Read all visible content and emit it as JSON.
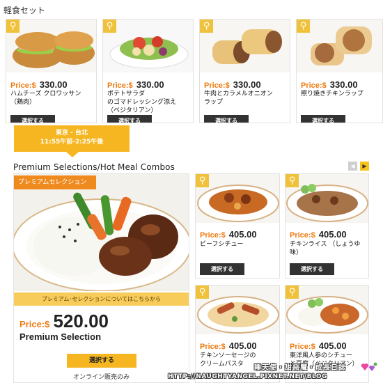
{
  "section1": {
    "title": "軽食セット",
    "items": [
      {
        "price_label": "Price:$",
        "price": "330.00",
        "name": "ハムチーズ クロワッサン\n（鶏肉）",
        "button": "選択する",
        "icon": "zoom-icon"
      },
      {
        "price_label": "Price:$",
        "price": "330.00",
        "name": "ポテトサラダ\nのゴマドレッシング添え\n（ベジタリアン）",
        "button": "選択する",
        "icon": "zoom-icon"
      },
      {
        "price_label": "Price:$",
        "price": "330.00",
        "name": "牛肉とカラメルオニオン\nラップ",
        "button": "選択する",
        "icon": "zoom-icon"
      },
      {
        "price_label": "Price:$",
        "price": "330.00",
        "name": "照り焼きチキンラップ",
        "button": "選択する",
        "icon": "zoom-icon"
      }
    ]
  },
  "flight": {
    "route": "東京 - 台北",
    "time": "11:55午前-2:25午後"
  },
  "section2": {
    "title": "Premium Selections/Hot Meal Combos",
    "nav_prev_icon": "arrow-left-icon",
    "nav_next_icon": "arrow-right-icon",
    "premium": {
      "banner": "プレミアムセレクション",
      "link": "プレミアム･セレクションについてはこちらから",
      "price_label": "Price:$",
      "price": "520.00",
      "name": "Premium Selection",
      "button": "選択する",
      "note": "オンライン販売のみ"
    },
    "items": [
      {
        "price_label": "Price:$",
        "price": "405.00",
        "name": "ビーフシチュー",
        "button": "選択する",
        "icon": "zoom-icon"
      },
      {
        "price_label": "Price:$",
        "price": "405.00",
        "name": "チキンライス （しょうゆ味）",
        "button": "選択する",
        "icon": "zoom-icon"
      },
      {
        "price_label": "Price:$",
        "price": "405.00",
        "name": "チキンソーセージの\nクリームパスタ",
        "button": "",
        "icon": "zoom-icon"
      },
      {
        "price_label": "Price:$",
        "price": "405.00",
        "name": "東洋風人参のシチュー\nと豆腐（ベジタリアン）",
        "button": "",
        "icon": "zoom-icon"
      }
    ]
  },
  "watermark": {
    "line1": "睡天使・甜惡魔・成長日誌",
    "line2": "HTTP://NAUGHTYANGEL.PIXNET.NET/BLOG"
  },
  "colors": {
    "accent_orange": "#ef7a10",
    "tab_yellow": "#f5b621",
    "zoom_yellow": "#f0c13a",
    "button_dark": "#333333"
  }
}
